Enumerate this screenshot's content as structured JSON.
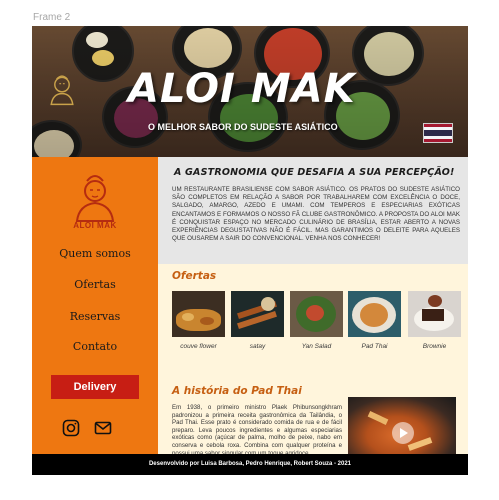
{
  "frame_label": "Frame 2",
  "hero": {
    "title": "ALOI MAK",
    "subtitle": "O MELHOR SABOR DO SUDESTE ASIÁTICO",
    "flag": "thailand-flag"
  },
  "sidebar": {
    "logo_text": "ALOI MAK",
    "items": [
      {
        "label": "Quem somos"
      },
      {
        "label": "Ofertas"
      },
      {
        "label": "Reservas"
      },
      {
        "label": "Contato"
      }
    ],
    "delivery_label": "Delivery",
    "social": [
      "instagram-icon",
      "mail-icon"
    ]
  },
  "intro": {
    "title": "A GASTRONOMIA QUE DESAFIA A SUA PERCEPÇÃO!",
    "text": "UM RESTAURANTE BRASILIENSE COM SABOR ASIÁTICO. OS PRATOS DO SUDESTE ASIÁTICO SÃO COMPLETOS EM RELAÇÃO A SABOR POR TRABALHAREM COM EXCELÊNCIA O DOCE, SALGADO, AMARGO, AZEDO E UMAMI. COM TEMPEROS E ESPECIARIAS EXÓTICAS ENCANTAMOS E FORMAMOS O NOSSO FÃ CLUBE GASTRONÔMICO. A PROPOSTA DO ALOI MAK É CONQUISTAR ESPAÇO NO MERCADO CULINÁRIO DE BRASÍLIA, ESTAR ABERTO A NOVAS EXPERIÊNCIAS DEGUSTATIVAS NÃO É FÁCIL. MAS GARANTIMOS O DELEITE PARA AQUELES QUE OUSAREM A SAIR DO CONVENCIONAL. VENHA NOS CONHECER!"
  },
  "ofertas": {
    "title": "Ofertas",
    "items": [
      {
        "label": "couve flower"
      },
      {
        "label": "satay"
      },
      {
        "label": "Yan Salad"
      },
      {
        "label": "Pad Thai"
      },
      {
        "label": "Brownie"
      }
    ]
  },
  "history": {
    "title": "A história do Pad Thai",
    "text": "Em 1938, o primeiro ministro Plaek Phibunsongkhram padronizou a primeira receita gastronômica da Tailândia, o Pad Thai. Esse prato é considerado comida de rua e de fácil preparo. Leva poucos ingredientes e algumas especiarias exóticas como (açúcar de palma, molho de peixe, nabo em conserva e cebola roxa. Combina com qualquer proteína e possui uma sabor singular com um toque agridoce."
  },
  "footer": {
    "text": "Desenvolvido por Luisa Barbosa, Pedro Henrique, Robert Souza - 2021"
  },
  "colors": {
    "sidebar": "#ee7711",
    "delivery": "#c71e14",
    "intro_bg": "#e6e6e6",
    "ofertas_bg": "#fff5dc",
    "accent_title": "#c65f12",
    "footer": "#000000"
  }
}
